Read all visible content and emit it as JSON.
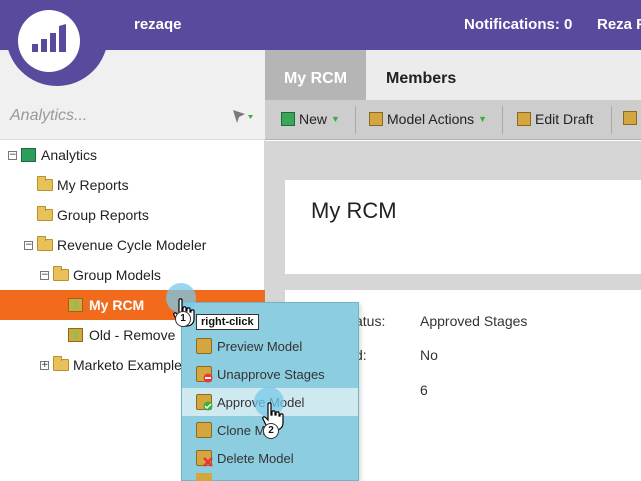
{
  "header": {
    "username": "rezaqe",
    "notifications": "Notifications: 0",
    "user_right": "Reza F"
  },
  "left": {
    "search_placeholder": "Analytics...",
    "tree": [
      {
        "label": "Analytics",
        "expander": "−"
      },
      {
        "label": "My Reports"
      },
      {
        "label": "Group Reports"
      },
      {
        "label": "Revenue Cycle Modeler",
        "expander": "−"
      },
      {
        "label": "Group Models",
        "expander": "−"
      },
      {
        "label": "My RCM"
      },
      {
        "label": "Old - Remove"
      },
      {
        "label": "Marketo Example",
        "expander": "+"
      }
    ]
  },
  "tabs": {
    "active": "My RCM",
    "members": "Members"
  },
  "toolbar": {
    "new": "New",
    "model_actions": "Model Actions",
    "edit_draft": "Edit Draft"
  },
  "main": {
    "title": "My RCM",
    "details": [
      {
        "label": "atus:",
        "value": "Approved Stages"
      },
      {
        "label": "d:",
        "value": "No"
      },
      {
        "label": "",
        "value": "6"
      }
    ]
  },
  "context_menu": {
    "items": [
      "raft",
      "Preview Model",
      "Unapprove Stages",
      "Approve Model",
      "Clone M",
      "Delete Model"
    ]
  },
  "annotations": {
    "step1": "1",
    "step1_tip": "right-click",
    "step2": "2"
  },
  "colors": {
    "header": "#5a4a9e",
    "selected": "#f26b1d",
    "menu": "#8ccde0",
    "menu_hover": "#cfe9f0"
  }
}
